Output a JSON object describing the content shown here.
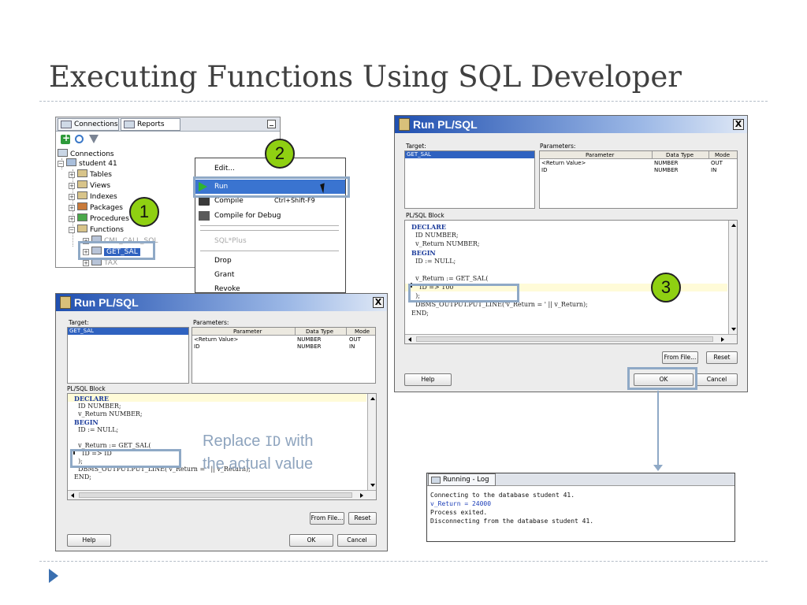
{
  "slide": {
    "title": "Executing Functions Using SQL Developer"
  },
  "navigator": {
    "tabs": [
      "Connections",
      "Reports"
    ],
    "tree": [
      {
        "label": "Connections"
      },
      {
        "label": "student 41"
      },
      {
        "label": "Tables"
      },
      {
        "label": "Views"
      },
      {
        "label": "Indexes"
      },
      {
        "label": "Packages"
      },
      {
        "label": "Procedures"
      },
      {
        "label": "Functions"
      },
      {
        "label": "CML_CALL_SQL"
      },
      {
        "label": "GET_SAL"
      },
      {
        "label": "TAX"
      }
    ]
  },
  "context_menu": {
    "items": [
      {
        "label": "Edit..."
      },
      {
        "label": "Run"
      },
      {
        "label": "Compile",
        "shortcut": "Ctrl+Shift-F9"
      },
      {
        "label": "Compile for Debug"
      },
      {
        "label": "SQL*Plus"
      },
      {
        "label": "Drop"
      },
      {
        "label": "Grant"
      },
      {
        "label": "Revoke"
      }
    ]
  },
  "dialog": {
    "title": "Run PL/SQL",
    "close": "X",
    "target_label": "Target:",
    "target_value": "GET_SAL",
    "params_label": "Parameters:",
    "param_headers": [
      "Parameter",
      "Data Type",
      "Mode"
    ],
    "params": [
      {
        "name": "<Return Value>",
        "type": "NUMBER",
        "mode": "OUT"
      },
      {
        "name": "ID",
        "type": "NUMBER",
        "mode": "IN"
      }
    ],
    "block_label": "PL/SQL Block",
    "code_lines_left": [
      "DECLARE",
      "  ID NUMBER;",
      "  v_Return NUMBER;",
      "BEGIN",
      "  ID := NULL;",
      "",
      "  v_Return := GET_SAL(",
      "    ID => ID",
      "  );",
      "  DBMS_OUTPUT.PUT_LINE('v_Return = ' || v_Return);",
      "END;"
    ],
    "code_lines_right": [
      "DECLARE",
      "  ID NUMBER;",
      "  v_Return NUMBER;",
      "BEGIN",
      "  ID := NULL;",
      "",
      "  v_Return := GET_SAL(",
      "    ID => 100",
      "  );",
      "  DBMS_OUTPUT.PUT_LINE('v_Return = ' || v_Return);",
      "END;"
    ],
    "buttons": {
      "from_file": "From File...",
      "reset": "Reset",
      "help": "Help",
      "ok": "OK",
      "cancel": "Cancel"
    }
  },
  "callout": {
    "line1_prefix": "Replace ",
    "line1_code": "ID",
    "line1_suffix": " with",
    "line2": "the actual value"
  },
  "steps": [
    "1",
    "2",
    "3"
  ],
  "log": {
    "tab": "Running - Log",
    "lines": [
      "Connecting to the database student 41.",
      "v_Return = 24000",
      "Process exited.",
      "Disconnecting from the database student 41."
    ]
  },
  "colors": {
    "accent": "#8fa9c6",
    "badge": "#8fd012",
    "selection": "#2f62c0"
  }
}
